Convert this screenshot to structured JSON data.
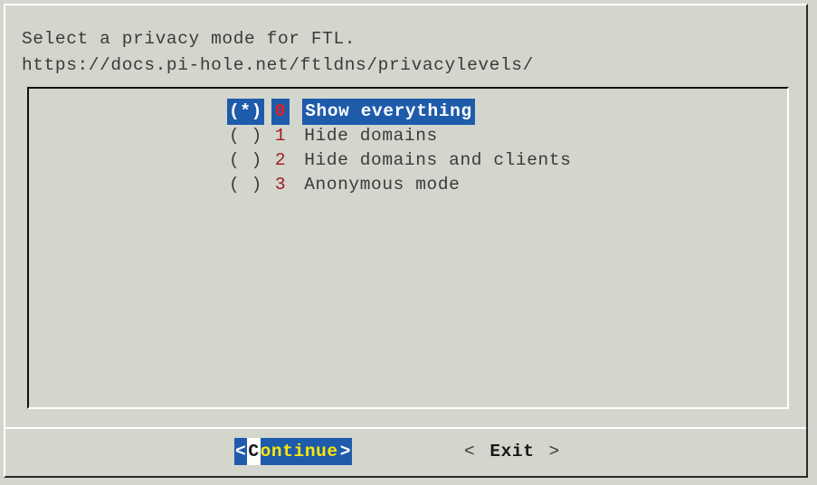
{
  "dialog": {
    "prompt_lines": [
      "Select a privacy mode for FTL.",
      "https://docs.pi-hole.net/ftldns/privacylevels/"
    ],
    "selected_index": 0,
    "options": [
      {
        "marker": "(*)",
        "digit": "0",
        "label": "Show everything",
        "selected": true
      },
      {
        "marker": "( )",
        "digit": "1",
        "label": "Hide domains",
        "selected": false
      },
      {
        "marker": "( )",
        "digit": "2",
        "label": "Hide domains and clients",
        "selected": false
      },
      {
        "marker": "( )",
        "digit": "3",
        "label": "Anonymous mode",
        "selected": false
      }
    ],
    "buttons": {
      "continue": {
        "left_bracket": "<",
        "first_char": "C",
        "rest": "ontinue",
        "right_bracket": ">",
        "focused": true
      },
      "exit": {
        "left_bracket": "<",
        "first_char": "E",
        "rest": "xit",
        "right_bracket": ">",
        "focused": false
      }
    }
  },
  "colors": {
    "background": "#d2d6cd",
    "highlight_blue": "#1f5bab",
    "highlight_text": "#ffffff",
    "digit_red": "#a21a21",
    "selected_digit_red": "#e02020",
    "button_yellow": "#ffe800",
    "text_gray": "#3b3b3b",
    "shadow_dark": "#2b2b2b",
    "highlight_white": "#ffffff"
  }
}
